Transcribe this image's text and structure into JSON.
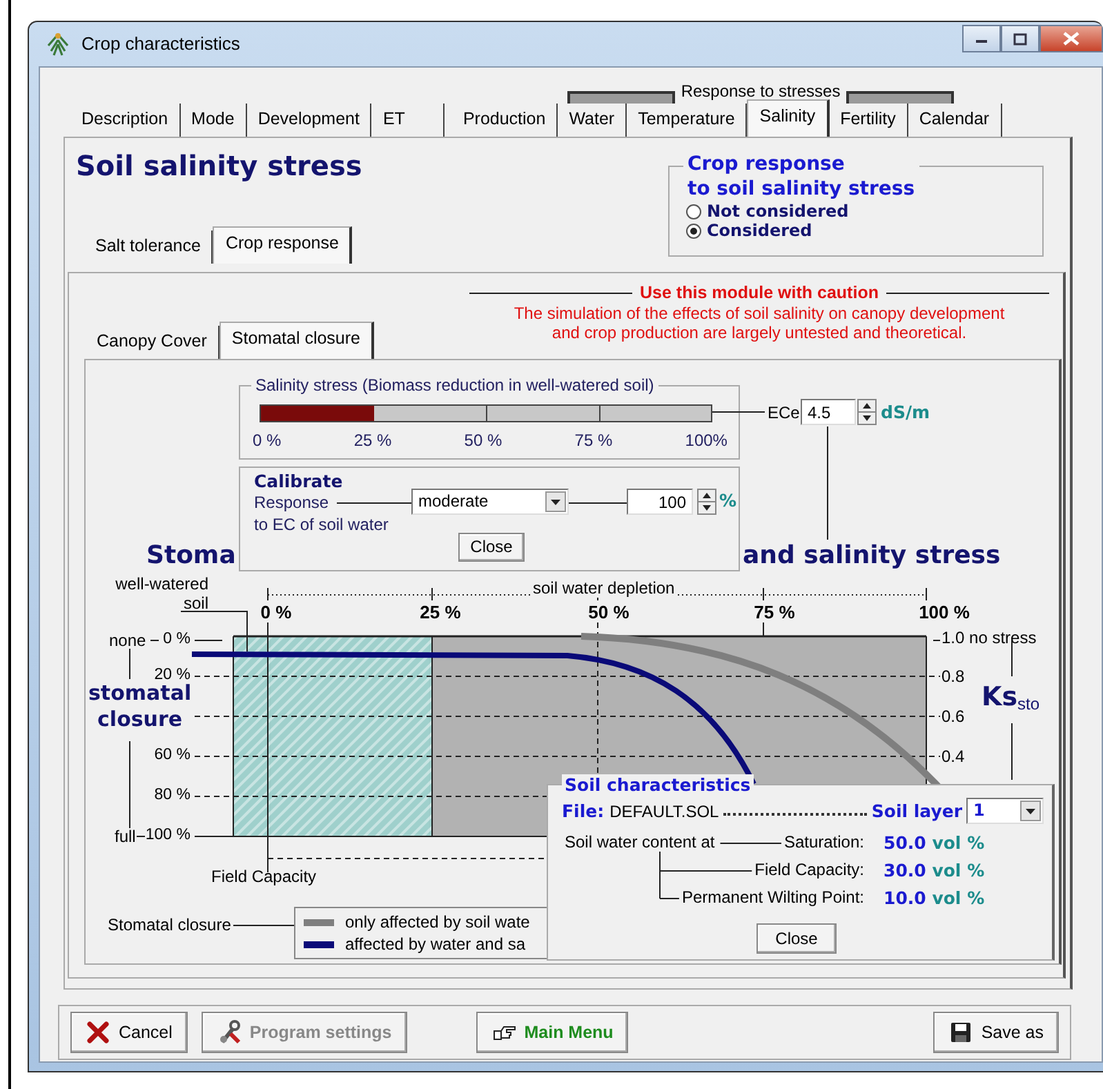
{
  "window": {
    "title": "Crop characteristics"
  },
  "tab_group_label": "Response to stresses",
  "tabs": [
    {
      "label": "Description",
      "selected": false
    },
    {
      "label": "Mode",
      "selected": false
    },
    {
      "label": "Development",
      "selected": false
    },
    {
      "label": "ET",
      "selected": false
    },
    {
      "label": "Production",
      "selected": false
    },
    {
      "label": "Water",
      "selected": false
    },
    {
      "label": "Temperature",
      "selected": false
    },
    {
      "label": "Salinity",
      "selected": true
    },
    {
      "label": "Fertility",
      "selected": false
    },
    {
      "label": "Calendar",
      "selected": false
    }
  ],
  "heading": "Soil salinity stress",
  "crop_response": {
    "title_lines": [
      "Crop response",
      "to soil salinity stress"
    ],
    "options": [
      {
        "label": "Not considered",
        "selected": false
      },
      {
        "label": "Considered",
        "selected": true
      }
    ]
  },
  "subtabs": [
    {
      "label": "Salt tolerance",
      "selected": false
    },
    {
      "label": "Crop response",
      "selected": true
    }
  ],
  "caution": {
    "title": "Use this module with caution",
    "lines": [
      "The simulation of the effects of soil salinity on canopy development",
      "and crop production are largely untested and theoretical."
    ]
  },
  "inner_tabs": [
    {
      "label": "Canopy Cover",
      "selected": false
    },
    {
      "label": "Stomatal closure",
      "selected": true
    }
  ],
  "salinity_stress": {
    "title": "Salinity stress (Biomass reduction in well-watered soil)",
    "level": 0.25,
    "ticks": [
      "0 %",
      "25 %",
      "50 %",
      "75 %",
      "100%"
    ],
    "ece_label": "ECe",
    "ece_value": "4.5",
    "ece_unit": "dS/m"
  },
  "calibrate": {
    "title": "Calibrate",
    "response_label": "Response",
    "response_label_2": "to EC of soil water",
    "response": "moderate",
    "percent": "100",
    "percent_unit": "%",
    "close": "Close"
  },
  "diagram": {
    "title_left": "Stoma",
    "title_right": "and salinity stress",
    "top_axis_title": "soil water depletion",
    "well_watered": [
      "well-watered",
      "soil"
    ],
    "top_ticks": [
      "0 %",
      "25 %",
      "50 %",
      "75 %",
      "100 %"
    ],
    "left_end_top": "none",
    "left_end_bottom": "full",
    "left_ticks": [
      "0 %",
      "20 %",
      "60 %",
      "80 %",
      "100 %"
    ],
    "left_title": [
      "stomatal",
      "closure"
    ],
    "right_ticks": [
      "1.0 no stress",
      "0.8",
      "0.6",
      "0.4"
    ],
    "right_title": "Ks$_{sto}$",
    "field_capacity": "Field Capacity",
    "legend_label": "Stomatal closure",
    "legend": [
      {
        "label": "only affected by soil wate",
        "color": "#7f7f7f"
      },
      {
        "label": "affected by water and sa",
        "color": "#0a0a78"
      }
    ]
  },
  "soil": {
    "title": "Soil characteristics",
    "file_label": "File:",
    "file": "DEFAULT.SOL",
    "layer_label": "Soil layer",
    "layer": "1",
    "content_label": "Soil water content at",
    "rows": [
      {
        "label": "Saturation:",
        "value": "50.0",
        "unit": "vol %"
      },
      {
        "label": "Field Capacity:",
        "value": "30.0",
        "unit": "vol %"
      },
      {
        "label": "Permanent Wilting Point:",
        "value": "10.0",
        "unit": "vol %"
      }
    ],
    "close": "Close"
  },
  "buttons": [
    {
      "kind": "cancel",
      "label": "Cancel",
      "disabled": false
    },
    {
      "kind": "settings",
      "label": "Program settings",
      "disabled": true
    },
    {
      "kind": "menu",
      "label": "Main Menu",
      "disabled": false
    },
    {
      "kind": "save",
      "label": "Save as",
      "disabled": false
    }
  ]
}
